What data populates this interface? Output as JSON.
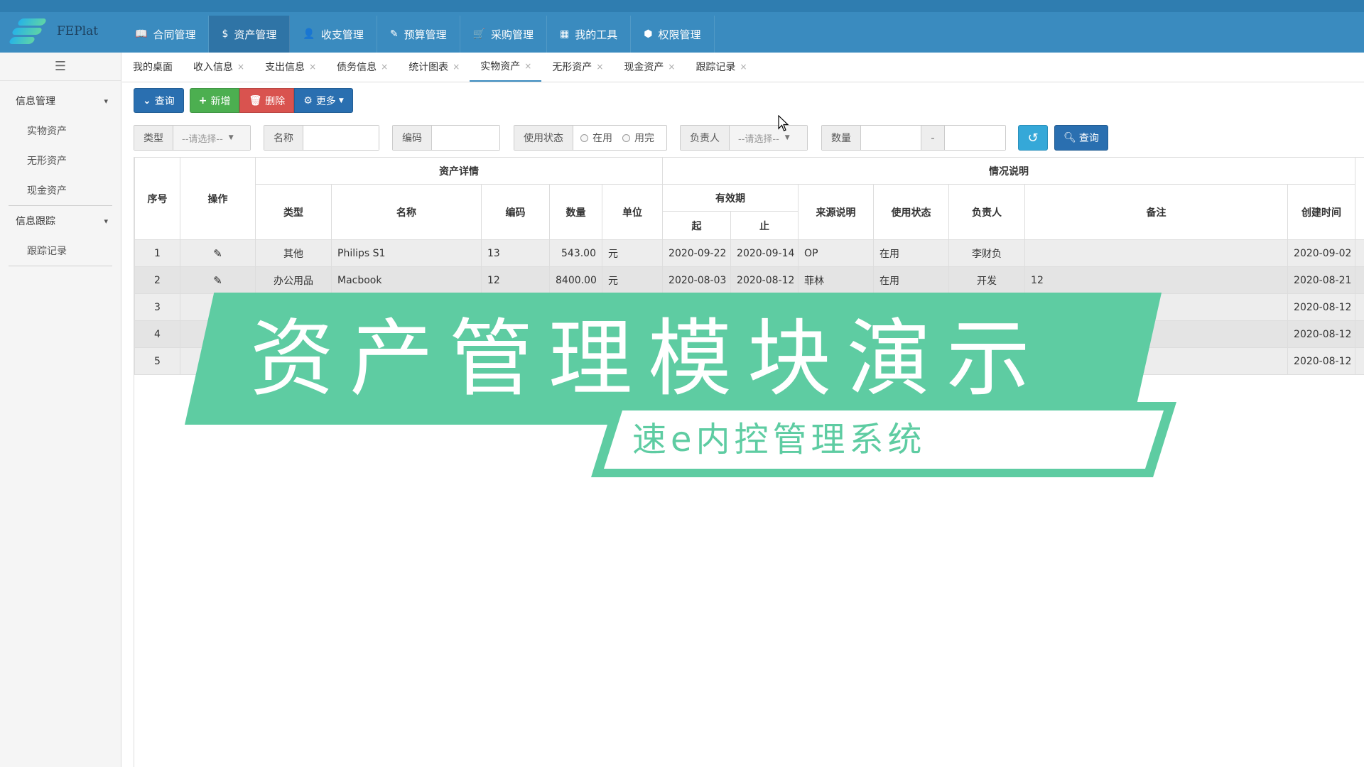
{
  "app": {
    "logo_text": "FEPlat"
  },
  "nav": {
    "items": [
      {
        "icon": "book-icon",
        "glyph": "📖",
        "label": "合同管理"
      },
      {
        "icon": "dollar-icon",
        "glyph": "$",
        "label": "资产管理"
      },
      {
        "icon": "user-icon",
        "glyph": "👤",
        "label": "收支管理"
      },
      {
        "icon": "edit-icon",
        "glyph": "✎",
        "label": "预算管理"
      },
      {
        "icon": "cart-icon",
        "glyph": "🛒",
        "label": "采购管理"
      },
      {
        "icon": "calendar-icon",
        "glyph": "▦",
        "label": "我的工具"
      },
      {
        "icon": "settings-icon",
        "glyph": "⬢",
        "label": "权限管理"
      }
    ],
    "active_index": 1
  },
  "sidebar": {
    "groups": [
      {
        "label": "信息管理",
        "items": [
          "实物资产",
          "无形资产",
          "现金资产"
        ]
      },
      {
        "label": "信息跟踪",
        "items": [
          "跟踪记录"
        ]
      }
    ]
  },
  "tabs": [
    {
      "label": "我的桌面",
      "closable": false
    },
    {
      "label": "收入信息",
      "closable": true
    },
    {
      "label": "支出信息",
      "closable": true
    },
    {
      "label": "债务信息",
      "closable": true
    },
    {
      "label": "统计图表",
      "closable": true
    },
    {
      "label": "实物资产",
      "closable": true,
      "active": true
    },
    {
      "label": "无形资产",
      "closable": true
    },
    {
      "label": "现金资产",
      "closable": true
    },
    {
      "label": "跟踪记录",
      "closable": true
    }
  ],
  "toolbar": {
    "query_label": "查询",
    "add_label": "新增",
    "delete_label": "删除",
    "more_label": "更多"
  },
  "filters": {
    "type_label": "类型",
    "type_select": "--请选择--",
    "name_label": "名称",
    "code_label": "编码",
    "status_label": "使用状态",
    "status_opt1": "在用",
    "status_opt2": "用完",
    "owner_label": "负责人",
    "owner_select": "--请选择--",
    "qty_label": "数量",
    "qty_sep": "-",
    "search_label": "查询"
  },
  "table": {
    "h_group_detail": "资产详情",
    "h_group_status": "情况说明",
    "h_validity": "有效期",
    "h_seq": "序号",
    "h_op": "操作",
    "h_type": "类型",
    "h_name": "名称",
    "h_code": "编码",
    "h_qty": "数量",
    "h_unit": "单位",
    "h_from": "起",
    "h_to": "止",
    "h_source": "来源说明",
    "h_status": "使用状态",
    "h_owner": "负责人",
    "h_remark": "备注",
    "h_created": "创建时间",
    "rows": [
      {
        "seq": "1",
        "type": "其他",
        "name": "Philips S1",
        "code": "13",
        "qty": "543.00",
        "unit": "元",
        "from": "2020-09-22",
        "to": "2020-09-14",
        "source": "OP",
        "status": "在用",
        "owner": "李财负",
        "remark": "",
        "created": "2020-09-02"
      },
      {
        "seq": "2",
        "type": "办公用品",
        "name": "Macbook",
        "code": "12",
        "qty": "8400.00",
        "unit": "元",
        "from": "2020-08-03",
        "to": "2020-08-12",
        "source": "菲林",
        "status": "在用",
        "owner": "开发",
        "remark": "12",
        "created": "2020-08-21"
      },
      {
        "seq": "3",
        "type": "",
        "name": "",
        "code": "",
        "qty": "",
        "unit": "",
        "from": "",
        "to": "",
        "source": "",
        "status": "",
        "owner": "",
        "remark": "",
        "created": "2020-08-12"
      },
      {
        "seq": "4",
        "type": "",
        "name": "",
        "code": "",
        "qty": "",
        "unit": "",
        "from": "",
        "to": "",
        "source": "",
        "status": "",
        "owner": "",
        "remark": "",
        "created": "2020-08-12"
      },
      {
        "seq": "5",
        "type": "",
        "name": "",
        "code": "",
        "qty": "",
        "unit": "",
        "from": "",
        "to": "",
        "source": "",
        "status": "",
        "owner": "",
        "remark": "",
        "created": "2020-08-12"
      }
    ]
  },
  "overlay": {
    "title": "资产管理模块演示",
    "subtitle": "速e内控管理系统",
    "accent": "#5ecca2"
  }
}
